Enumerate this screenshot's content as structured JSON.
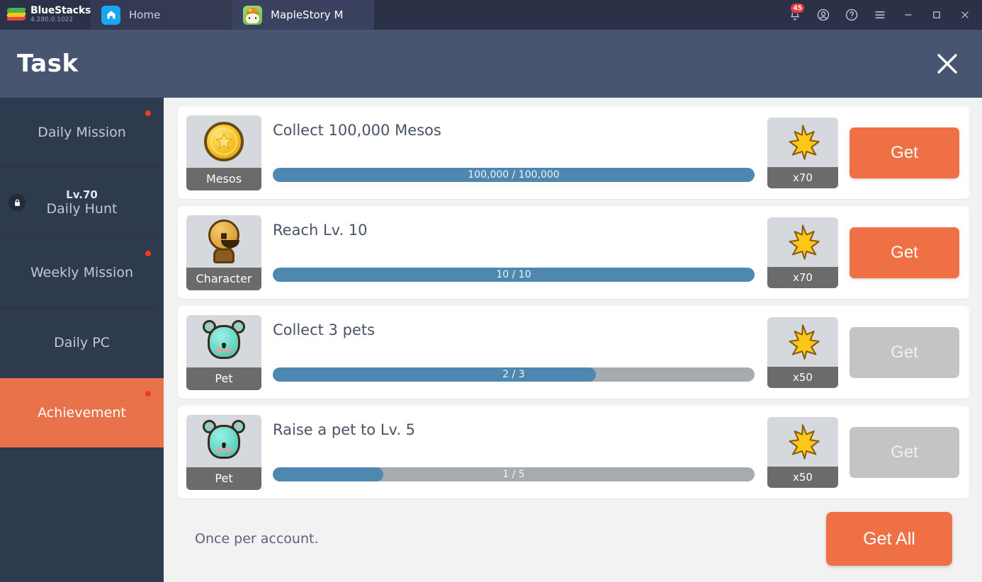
{
  "titlebar": {
    "brand_name": "BlueStacks",
    "brand_version": "4.280.0.1022",
    "tabs": [
      {
        "label": "Home",
        "icon": "home-icon",
        "active": false
      },
      {
        "label": "MapleStory M",
        "icon": "maplestory-game-icon",
        "active": true
      }
    ],
    "notification_count": "45",
    "actions": [
      "notifications-bell-icon",
      "account-icon",
      "help-icon",
      "menu-icon",
      "minimize-icon",
      "maximize-icon",
      "close-icon"
    ]
  },
  "header": {
    "title": "Task",
    "close_label": "close-icon"
  },
  "sidebar": {
    "items": [
      {
        "label": "Daily Mission",
        "sub": "",
        "locked": false,
        "badge": true,
        "active": false
      },
      {
        "label": "Daily Hunt",
        "sub": "Lv.70",
        "locked": true,
        "badge": false,
        "active": false
      },
      {
        "label": "Weekly Mission",
        "sub": "",
        "locked": false,
        "badge": true,
        "active": false
      },
      {
        "label": "Daily PC",
        "sub": "",
        "locked": false,
        "badge": false,
        "active": false
      },
      {
        "label": "Achievement",
        "sub": "",
        "locked": false,
        "badge": true,
        "active": true
      }
    ]
  },
  "tasks": [
    {
      "name": "Collect 100,000 Mesos",
      "icon": "mesos-coin-icon",
      "icon_label": "Mesos",
      "progress_text": "100,000 / 100,000",
      "progress_percent": 100,
      "reward_icon": "maple-leaf-icon",
      "reward_amount": "x70",
      "button_label": "Get",
      "button_enabled": true
    },
    {
      "name": "Reach Lv. 10",
      "icon": "character-face-icon",
      "icon_label": "Character",
      "progress_text": "10 / 10",
      "progress_percent": 100,
      "reward_icon": "maple-leaf-icon",
      "reward_amount": "x70",
      "button_label": "Get",
      "button_enabled": true
    },
    {
      "name": "Collect 3 pets",
      "icon": "pet-mouse-icon",
      "icon_label": "Pet",
      "progress_text": "2 / 3",
      "progress_percent": 67,
      "reward_icon": "maple-leaf-icon",
      "reward_amount": "x50",
      "button_label": "Get",
      "button_enabled": false
    },
    {
      "name": "Raise a pet to Lv. 5",
      "icon": "pet-mouse-icon",
      "icon_label": "Pet",
      "progress_text": "1 / 5",
      "progress_percent": 23,
      "reward_icon": "maple-leaf-icon",
      "reward_amount": "x50",
      "button_label": "Get",
      "button_enabled": false
    }
  ],
  "footer": {
    "note": "Once per account.",
    "get_all_label": "Get All"
  },
  "colors": {
    "accent_orange": "#ef7044",
    "sidebar_bg": "#2e3a4e",
    "header_bg": "#475570",
    "progress_blue": "#4e87af",
    "progress_track": "#a7aaaf",
    "badge_red": "#f03c18"
  }
}
